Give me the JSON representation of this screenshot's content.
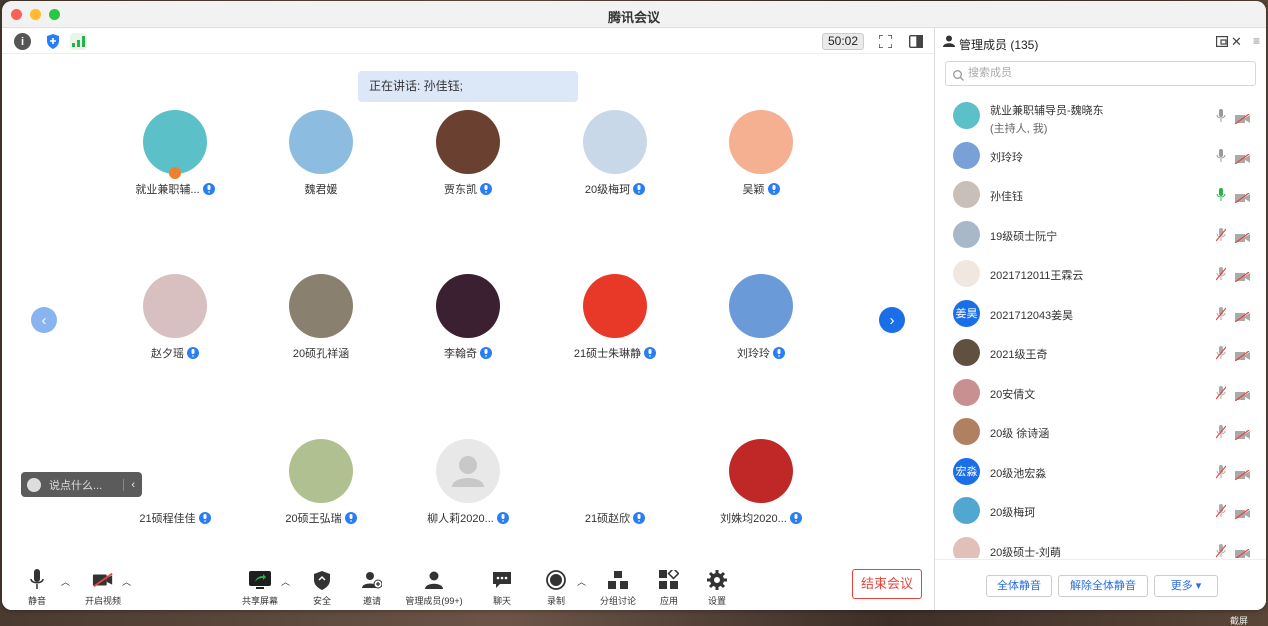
{
  "window": {
    "title": "腾讯会议"
  },
  "topbar": {
    "timer": "50:02"
  },
  "speaking": {
    "label": "正在讲话: 孙佳钰;"
  },
  "tiles": [
    {
      "name": "就业兼职辅...",
      "badge": "host",
      "color": "#5bc0c8"
    },
    {
      "name": "魏君媛",
      "badge": "none",
      "color": "#8cbde0"
    },
    {
      "name": "贾东凯",
      "badge": "mic",
      "color": "#6a4030"
    },
    {
      "name": "20级梅珂",
      "badge": "mic",
      "color": "#c8d8e8"
    },
    {
      "name": "吴颖",
      "badge": "mic",
      "color": "#f4b090"
    },
    {
      "name": "赵夕瑶",
      "badge": "mic",
      "color": "#d8c0c0"
    },
    {
      "name": "20硕孔祥涵",
      "badge": "none",
      "color": "#8a8070"
    },
    {
      "name": "李翰奇",
      "badge": "mic",
      "color": "#3a2030"
    },
    {
      "name": "21硕士朱琳静",
      "badge": "mic",
      "color": "#e83828"
    },
    {
      "name": "刘玲玲",
      "badge": "mic",
      "color": "#6a9ad8"
    },
    {
      "name": "21硕程佳佳",
      "badge": "mic",
      "color": "#ffffff"
    },
    {
      "name": "20硕王弘瑞",
      "badge": "mic",
      "color": "#b0c090"
    },
    {
      "name": "柳人莉2020...",
      "badge": "mic",
      "color": "#e8e8e8"
    },
    {
      "name": "21硕赵欣",
      "badge": "mic",
      "color": "#ffffff"
    },
    {
      "name": "刘姝均2020...",
      "badge": "mic",
      "color": "#c02828"
    }
  ],
  "chat": {
    "placeholder": "说点什么..."
  },
  "toolbar": {
    "mute": "静音",
    "video": "开启视频",
    "share": "共享屏幕",
    "security": "安全",
    "invite": "邀请",
    "manage": "管理成员(99+)",
    "chat": "聊天",
    "record": "录制",
    "breakout": "分组讨论",
    "apps": "应用",
    "settings": "设置",
    "end": "结束会议"
  },
  "panel": {
    "title": "管理成员 (135)",
    "search_placeholder": "搜索成员",
    "members": [
      {
        "name": "就业兼职辅导员-魏晓东",
        "sub": "(主持人, 我)",
        "color": "#5bc0c8",
        "mic": "on",
        "initials": ""
      },
      {
        "name": "刘玲玲",
        "sub": "",
        "color": "#7aa0d8",
        "mic": "on",
        "initials": ""
      },
      {
        "name": "孙佳钰",
        "sub": "",
        "color": "#c8c0b8",
        "mic": "active",
        "initials": ""
      },
      {
        "name": "19级硕士阮宁",
        "sub": "",
        "color": "#a8b8c8",
        "mic": "off",
        "initials": ""
      },
      {
        "name": "2021712011王霖云",
        "sub": "",
        "color": "#f0e8e0",
        "mic": "off",
        "initials": ""
      },
      {
        "name": "2021712043姜昊",
        "sub": "",
        "color": "#1a6ee8",
        "mic": "off",
        "initials": "姜昊"
      },
      {
        "name": "2021级王奇",
        "sub": "",
        "color": "#605040",
        "mic": "off",
        "initials": ""
      },
      {
        "name": "20安倩文",
        "sub": "",
        "color": "#c89090",
        "mic": "off",
        "initials": ""
      },
      {
        "name": "20级  徐诗涵",
        "sub": "",
        "color": "#b08060",
        "mic": "off",
        "initials": ""
      },
      {
        "name": "20级池宏淼",
        "sub": "",
        "color": "#1a6ee8",
        "mic": "off",
        "initials": "宏淼"
      },
      {
        "name": "20级梅珂",
        "sub": "",
        "color": "#50a8d0",
        "mic": "off",
        "initials": ""
      },
      {
        "name": "20级硕士-刘萌",
        "sub": "",
        "color": "#e0c0b8",
        "mic": "off",
        "initials": ""
      }
    ],
    "mute_all": "全体静音",
    "unmute_all": "解除全体静音",
    "more": "更多 ▾"
  },
  "desktop": {
    "corner": "截屏"
  }
}
